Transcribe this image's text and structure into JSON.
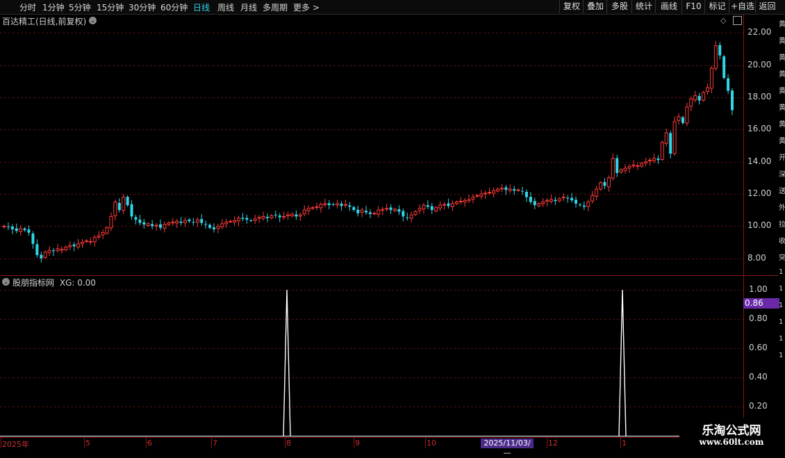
{
  "toolbar": {
    "periods": [
      "分时",
      "1分钟",
      "5分钟",
      "15分钟",
      "30分钟",
      "60分钟",
      "日线",
      "周线",
      "月线",
      "多周期",
      "更多 >"
    ],
    "active_period": "日线",
    "right_buttons": [
      "复权",
      "叠加",
      "多股",
      "统计",
      "画线",
      "F10",
      "标记",
      "+自选",
      "返回"
    ]
  },
  "main_chart": {
    "title": "百达精工(日线,前复权)",
    "price_axis": [
      "22.00",
      "20.00",
      "18.00",
      "16.00",
      "14.00",
      "12.00",
      "10.00",
      "8.00"
    ]
  },
  "indicator": {
    "title": "股朋指标网",
    "series_label": "XG: 0.00",
    "axis": [
      "1.00",
      "0.80",
      "0.60",
      "0.40",
      "0.20"
    ],
    "cursor_value": "0.86"
  },
  "time_axis": {
    "labels": [
      "2025年",
      "5",
      "6",
      "7",
      "8",
      "9",
      "10",
      "12",
      "1"
    ],
    "cursor_date": "2025/11/03/—"
  },
  "watermark": {
    "title": "乐淘公式网",
    "url": "www.60lt.com"
  },
  "right_strip_chars": [
    "黄",
    "黄",
    "黄",
    "黄",
    "黄",
    "黄",
    "黄",
    "黄",
    "开",
    "深",
    "送",
    "外",
    "拉",
    "收",
    "突",
    "1",
    "1",
    "1",
    "1",
    "1",
    "1"
  ],
  "colors": {
    "up": "#ff3b3b",
    "down": "#2fd6e8",
    "grid": "#5a0f0f",
    "frame": "#8a1414",
    "signal": "#ffffff"
  },
  "chart_data": {
    "type": "candlestick",
    "y_range": [
      7.6,
      22.4
    ],
    "indicator_range": [
      0,
      1
    ],
    "signal_spikes_x_labels": [
      "8",
      "1"
    ],
    "closes": [
      10.0,
      9.95,
      9.8,
      9.7,
      9.85,
      9.75,
      9.6,
      8.9,
      8.2,
      8.0,
      8.4,
      8.5,
      8.45,
      8.6,
      8.55,
      8.7,
      8.8,
      8.75,
      8.9,
      9.0,
      9.1,
      9.05,
      9.3,
      9.4,
      9.6,
      9.9,
      10.6,
      11.5,
      11.0,
      11.8,
      11.3,
      10.6,
      10.4,
      10.2,
      10.1,
      10.15,
      10.0,
      10.05,
      9.9,
      10.1,
      10.2,
      10.25,
      10.3,
      10.2,
      10.35,
      10.3,
      10.25,
      10.4,
      10.2,
      10.1,
      9.9,
      9.8,
      10.0,
      10.15,
      10.25,
      10.3,
      10.35,
      10.5,
      10.45,
      10.4,
      10.35,
      10.45,
      10.55,
      10.6,
      10.5,
      10.65,
      10.7,
      10.55,
      10.6,
      10.7,
      10.75,
      10.6,
      10.7,
      11.0,
      11.1,
      11.15,
      11.2,
      11.35,
      11.4,
      11.3,
      11.35,
      11.4,
      11.25,
      11.35,
      11.2,
      11.0,
      10.8,
      11.0,
      10.85,
      10.75,
      10.8,
      11.0,
      11.05,
      11.1,
      11.0,
      11.05,
      10.9,
      10.6,
      10.5,
      10.7,
      10.9,
      11.1,
      11.3,
      11.2,
      11.0,
      11.15,
      11.3,
      11.35,
      11.25,
      11.4,
      11.5,
      11.55,
      11.6,
      11.65,
      11.8,
      11.9,
      12.0,
      12.05,
      12.1,
      12.2,
      12.3,
      12.35,
      12.25,
      12.3,
      12.2,
      12.25,
      12.15,
      11.8,
      11.5,
      11.3,
      11.4,
      11.5,
      11.6,
      11.65,
      11.55,
      11.7,
      11.8,
      11.75,
      11.6,
      11.4,
      11.3,
      11.2,
      11.5,
      11.9,
      12.3,
      12.7,
      12.5,
      13.0,
      14.2,
      13.3,
      13.5,
      13.6,
      13.7,
      13.8,
      13.75,
      13.9,
      14.0,
      14.1,
      14.2,
      14.1,
      15.2,
      15.8,
      14.5,
      16.5,
      16.8,
      16.4,
      17.4,
      17.9,
      18.1,
      17.8,
      18.3,
      18.6,
      19.8,
      21.2,
      20.6,
      19.2,
      18.4,
      17.2
    ]
  }
}
